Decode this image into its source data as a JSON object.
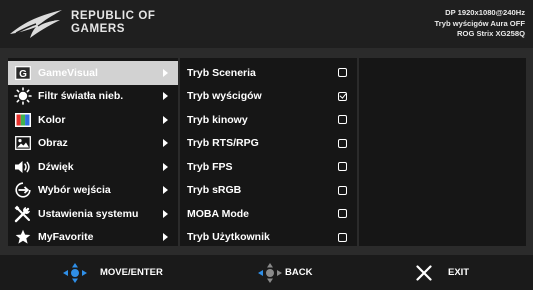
{
  "header": {
    "brand_line1": "REPUBLIC OF",
    "brand_line2": "GAMERS",
    "status_line1": "DP 1920x1080@240Hz",
    "status_line2": "Tryb wyścigów  Aura OFF",
    "status_line3": "ROG Strix XG258Q"
  },
  "main_menu": {
    "items": [
      {
        "label": "GameVisual",
        "icon": "gamevisual-icon",
        "selected": true
      },
      {
        "label": "Filtr światła nieb.",
        "icon": "bluelight-filter-icon"
      },
      {
        "label": "Kolor",
        "icon": "color-icon"
      },
      {
        "label": "Obraz",
        "icon": "image-icon"
      },
      {
        "label": "Dźwięk",
        "icon": "speaker-icon"
      },
      {
        "label": "Wybór wejścia",
        "icon": "input-select-icon"
      },
      {
        "label": "Ustawienia systemu",
        "icon": "system-settings-icon"
      },
      {
        "label": "MyFavorite",
        "icon": "star-icon"
      }
    ]
  },
  "submenu": {
    "options": [
      {
        "label": "Tryb Sceneria",
        "checked": false
      },
      {
        "label": "Tryb wyścigów",
        "checked": true
      },
      {
        "label": "Tryb kinowy",
        "checked": false
      },
      {
        "label": "Tryb RTS/RPG",
        "checked": false
      },
      {
        "label": "Tryb FPS",
        "checked": false
      },
      {
        "label": "Tryb sRGB",
        "checked": false
      },
      {
        "label": "MOBA Mode",
        "checked": false
      },
      {
        "label": "Tryb Użytkownik",
        "checked": false
      }
    ]
  },
  "footer": {
    "move_label": "MOVE/ENTER",
    "back_label": "BACK",
    "exit_label": "EXIT"
  },
  "colors": {
    "header_bg": "#1f1f1f",
    "panel_bg": "#161616",
    "frame_bg": "#2b2b2b",
    "selected_bg": "#d2d2d2",
    "joystick_blue": "#2f8fe8"
  }
}
